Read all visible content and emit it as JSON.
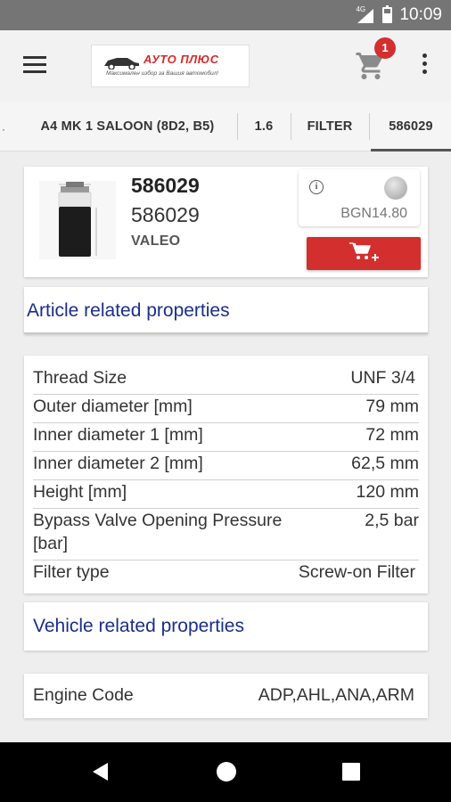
{
  "status_bar": {
    "network": "4G",
    "time": "10:09"
  },
  "app_bar": {
    "logo_text": "АУТО ПЛЮС",
    "logo_tagline": "Максимален избор за Вашия автомобил!",
    "cart_count": "1",
    "icons": {
      "menu": "hamburger-icon",
      "cart": "cart-icon",
      "more": "more-vert-icon"
    }
  },
  "breadcrumbs": [
    {
      "label": "A4 MK 1 SALOON (8D2, B5)"
    },
    {
      "label": "1.6"
    },
    {
      "label": "FILTER"
    },
    {
      "label": "586029",
      "active": true
    }
  ],
  "product": {
    "title": "586029",
    "number": "586029",
    "brand": "VALEO",
    "price": "BGN14.80",
    "availability_color": "#9e9e9e"
  },
  "sections": {
    "article": "Article related properties",
    "vehicle": "Vehicle related properties"
  },
  "article_properties": [
    {
      "key": "Thread Size",
      "value": "UNF 3/4"
    },
    {
      "key": "Outer diameter [mm]",
      "value": "79 mm"
    },
    {
      "key": "Inner diameter 1 [mm]",
      "value": "72 mm"
    },
    {
      "key": "Inner diameter 2 [mm]",
      "value": "62,5 mm"
    },
    {
      "key": "Height [mm]",
      "value": "120 mm"
    },
    {
      "key_line1": "Bypass Valve Opening Pressure",
      "key_line2": "[bar]",
      "value": "2,5 bar"
    },
    {
      "key": "Filter type",
      "value": "Screw-on Filter"
    }
  ],
  "vehicle_properties": [
    {
      "key": "Engine Code",
      "value": "ADP,AHL,ANA,ARM"
    }
  ],
  "colors": {
    "accent": "#d32f2f",
    "section_title": "#1a2e8c",
    "status_bar": "#757575"
  }
}
